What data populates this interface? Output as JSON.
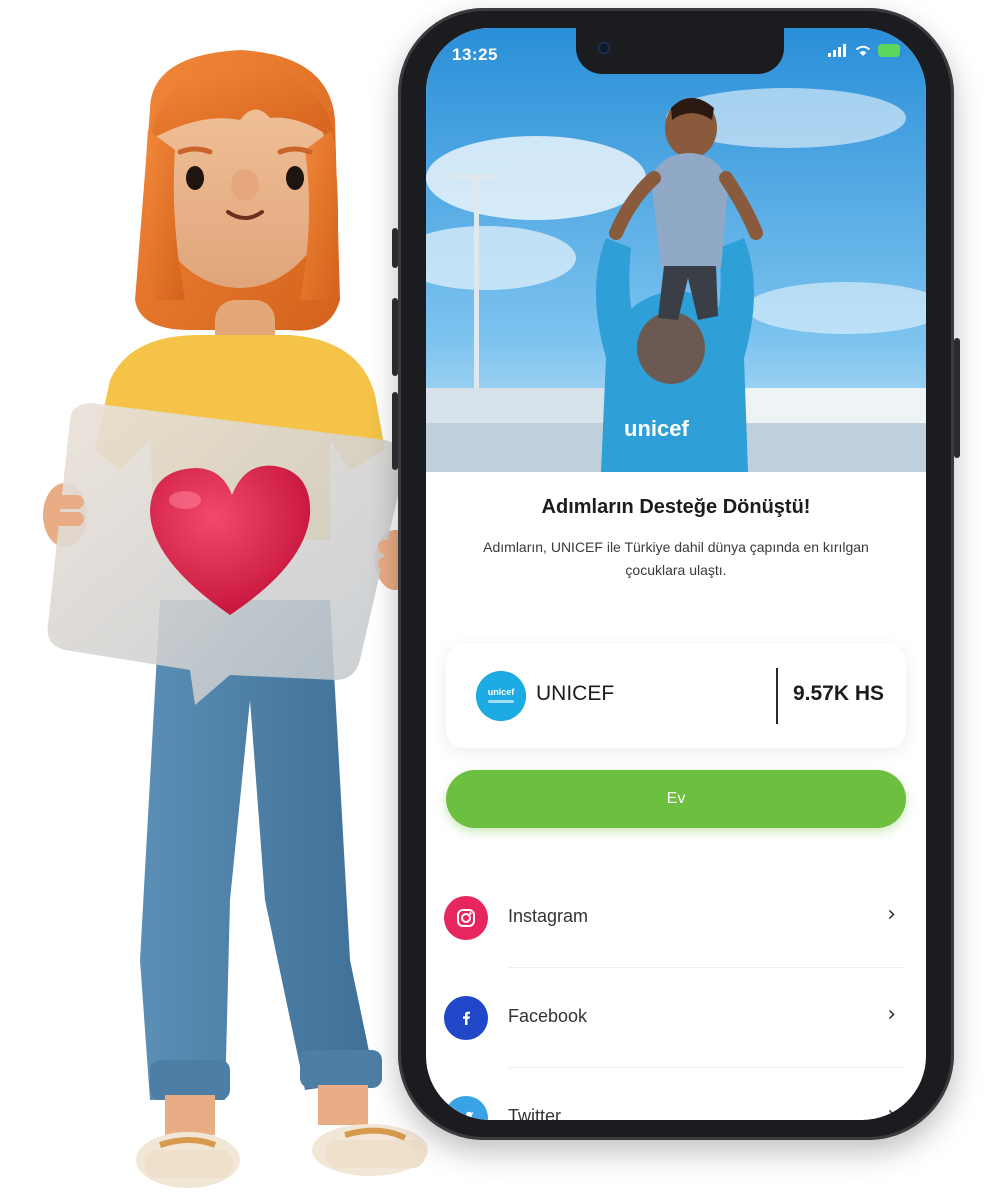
{
  "status_bar": {
    "time": "13:25"
  },
  "screen": {
    "title": "Adımların Desteğe Dönüştü!",
    "subtitle": "Adımların, UNICEF ile Türkiye dahil dünya çapında en kırılgan çocuklara ulaştı.",
    "hero_shirt_text": "unicef"
  },
  "org_card": {
    "logo_text": "unicef",
    "name": "UNICEF",
    "steps": "9.57K HS"
  },
  "primary_button": {
    "label": "Ev"
  },
  "social": [
    {
      "label": "Instagram",
      "icon": "instagram-icon",
      "color": "#e8265e"
    },
    {
      "label": "Facebook",
      "icon": "facebook-icon",
      "color": "#1f47c8"
    },
    {
      "label": "Twitter",
      "icon": "twitter-icon",
      "color": "#3aa3e6"
    }
  ],
  "colors": {
    "accent_green": "#6cbf3f",
    "unicef_blue": "#1cabe2",
    "heart_red": "#e02a4b"
  }
}
